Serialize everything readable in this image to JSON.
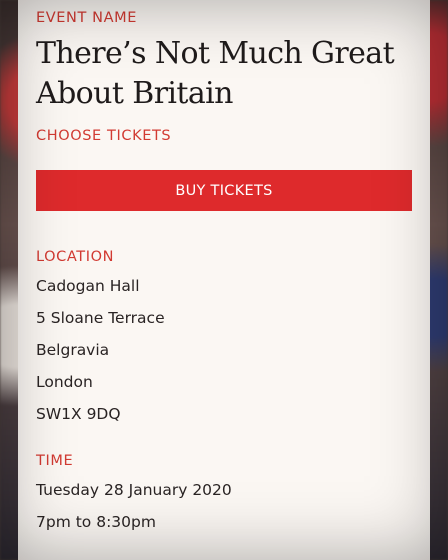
{
  "event": {
    "label": "EVENT NAME",
    "title": "There’s Not Much Great About Britain"
  },
  "tickets": {
    "label": "CHOOSE TICKETS",
    "buy_button": "BUY TICKETS"
  },
  "location": {
    "label": "LOCATION",
    "lines": [
      "Cadogan Hall",
      "5 Sloane Terrace",
      "Belgravia",
      "London",
      "SW1X 9DQ"
    ]
  },
  "time": {
    "label": "TIME",
    "date": "Tuesday 28 January 2020",
    "hours": "7pm to 8:30pm"
  },
  "colors": {
    "accent": "#de2a2c",
    "label": "#d23a32",
    "card": "#fbf7f3",
    "text": "#2a2424"
  }
}
